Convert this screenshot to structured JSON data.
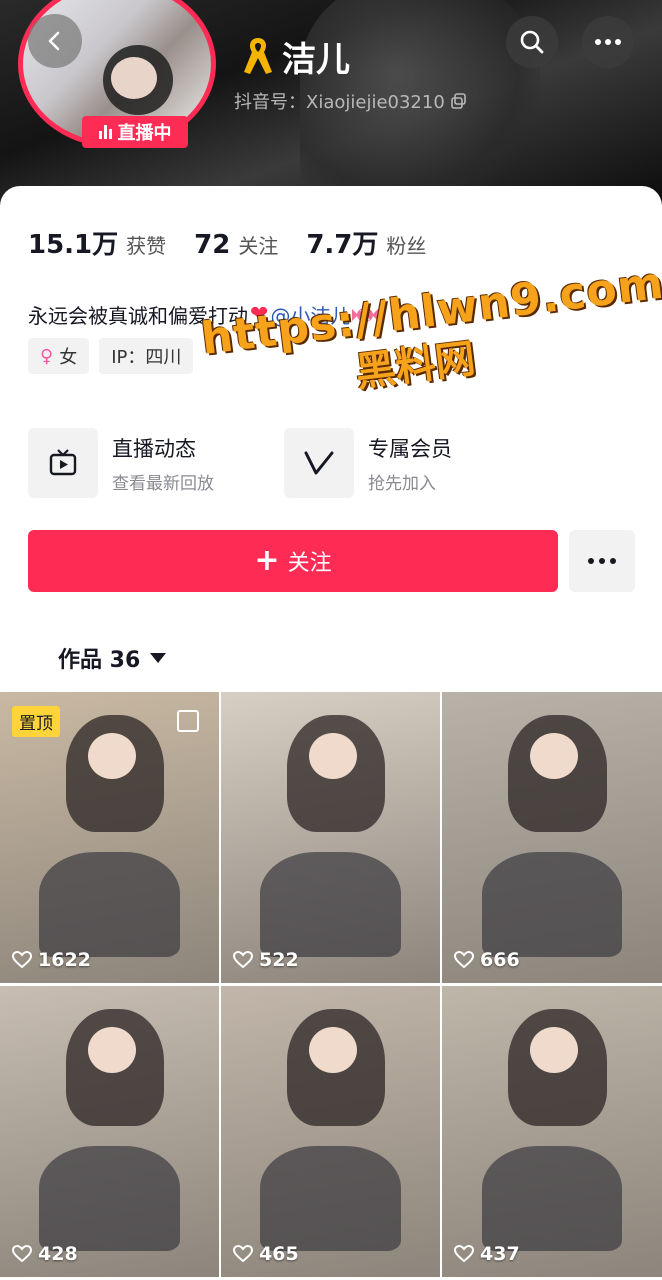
{
  "header": {
    "nickname": "洁儿",
    "douyin_id": "抖音号：Xiaojiejie03210",
    "live_badge": "直播中",
    "icons": [
      "back-icon",
      "search-icon",
      "more-icon",
      "ribbon-icon",
      "copy-icon"
    ]
  },
  "stats": [
    {
      "value": "15.1万",
      "label": "获赞"
    },
    {
      "value": "72",
      "label": "关注"
    },
    {
      "value": "7.7万",
      "label": "粉丝"
    }
  ],
  "bio": {
    "text": "永远会被真诚和偏爱打动",
    "heart": "❤",
    "mention": "@小洁儿"
  },
  "tags": [
    {
      "icon": "female-icon",
      "label": "女"
    },
    {
      "label": "IP：四川"
    }
  ],
  "entries": [
    {
      "title": "直播动态",
      "subtitle": "查看最新回放",
      "icon": "tv-icon"
    },
    {
      "title": "专属会员",
      "subtitle": "抢先加入",
      "icon": "vip-icon"
    }
  ],
  "follow_button": {
    "label": "关注"
  },
  "works_tab": {
    "label": "作品 36"
  },
  "videos": [
    {
      "likes": "1622",
      "pinned": "置顶",
      "bg": "#c9b9a3"
    },
    {
      "likes": "522",
      "bg": "#d7cfc4"
    },
    {
      "likes": "666",
      "bg": "#b8b2a8"
    },
    {
      "likes": "428",
      "bg": "#c7bdb2"
    },
    {
      "likes": "465",
      "bg": "#c2b6aa"
    },
    {
      "likes": "437",
      "bg": "#bfb6aa"
    }
  ],
  "watermark": {
    "line1": "https://hlwn9.com",
    "line2": "黑料网"
  },
  "colors": {
    "accent": "#fe2c55",
    "pin": "#ffd43b",
    "watermark": "#f7a21b"
  }
}
